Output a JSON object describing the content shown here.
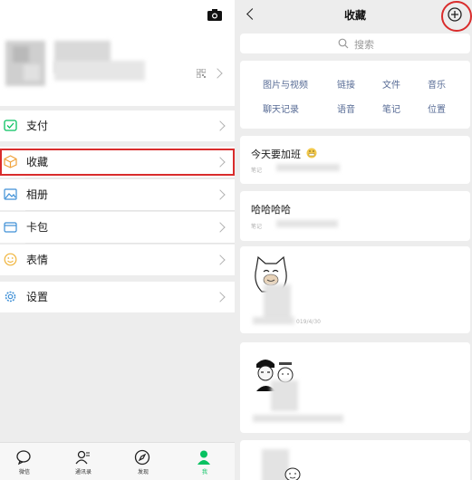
{
  "left": {
    "menu": [
      {
        "label": "支付",
        "icon": "pay-icon"
      },
      {
        "label": "收藏",
        "icon": "favorites-cube-icon"
      },
      {
        "label": "相册",
        "icon": "album-icon"
      },
      {
        "label": "卡包",
        "icon": "card-wallet-icon"
      },
      {
        "label": "表情",
        "icon": "emoji-smile-icon"
      },
      {
        "label": "设置",
        "icon": "settings-gear-icon"
      }
    ],
    "tabs": [
      {
        "label": "微信",
        "icon": "chat-bubble-icon",
        "active": false
      },
      {
        "label": "通讯录",
        "icon": "contacts-icon",
        "active": false
      },
      {
        "label": "发现",
        "icon": "compass-icon",
        "active": false
      },
      {
        "label": "我",
        "icon": "person-icon",
        "active": true
      }
    ]
  },
  "right": {
    "title": "收藏",
    "search_placeholder": "搜索",
    "categories": [
      [
        "图片与视频",
        "链接",
        "文件",
        "音乐"
      ],
      [
        "聊天记录",
        "语音",
        "笔记",
        "位置"
      ]
    ],
    "items": [
      {
        "title": "今天要加班",
        "meta": "笔记"
      },
      {
        "title": "哈哈哈哈",
        "meta": "笔记"
      },
      {
        "date": "019/4/30"
      }
    ]
  },
  "colors": {
    "brand_green": "#07c160",
    "link_blue": "#576b95",
    "highlight_red": "#d92c2c",
    "background": "#ededed"
  }
}
